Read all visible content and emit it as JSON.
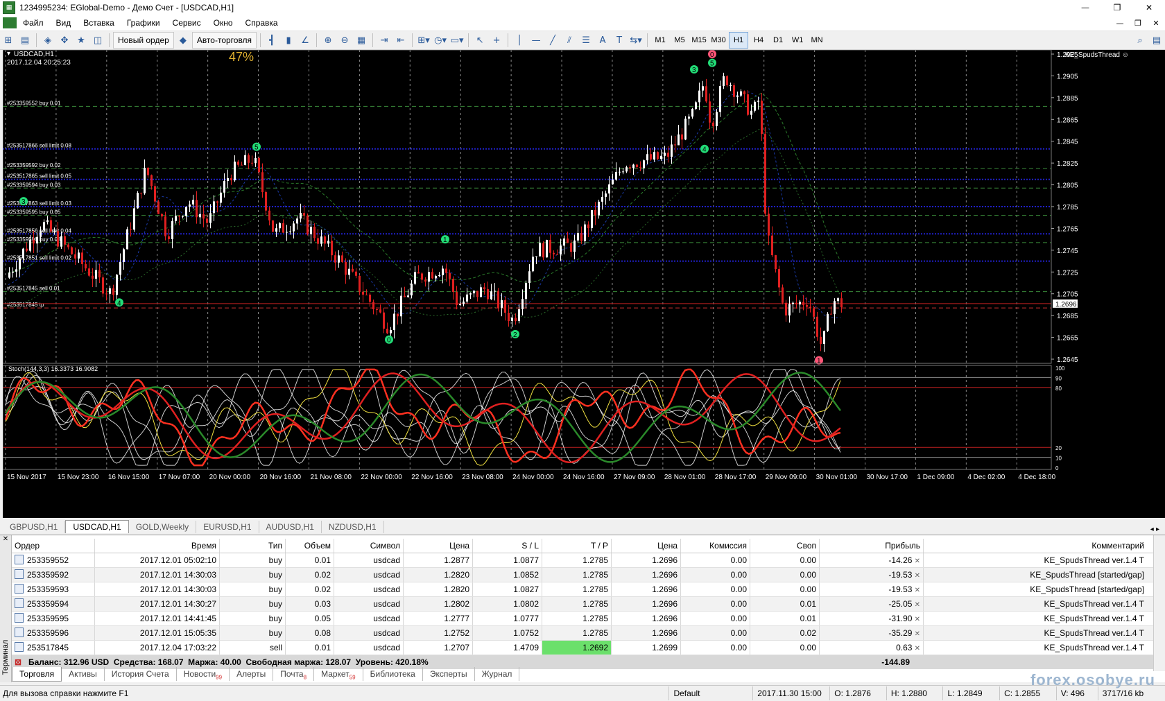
{
  "window": {
    "title": "1234995234: EGlobal-Demo - Демо Счет - [USDCAD,H1]",
    "minimize": "—",
    "maximize": "❐",
    "close": "✕"
  },
  "menu": [
    "Файл",
    "Вид",
    "Вставка",
    "Графики",
    "Сервис",
    "Окно",
    "Справка"
  ],
  "toolbar": {
    "new_order": "Новый ордер",
    "autotrading": "Авто-торговля",
    "timeframes": [
      "M1",
      "M5",
      "M15",
      "M30",
      "H1",
      "H4",
      "D1",
      "W1",
      "MN"
    ],
    "active_tf": "H1"
  },
  "chart": {
    "symbol_label": "USDCAD,H1",
    "datetime": "2017.12.04 20:25:23",
    "progress_label": "47%",
    "expert_label": "KE_SpudsThread ☺",
    "current_price": "1.2696",
    "price_axis": [
      "1.2925",
      "1.2905",
      "1.2885",
      "1.2865",
      "1.2845",
      "1.2825",
      "1.2805",
      "1.2785",
      "1.2765",
      "1.2745",
      "1.2725",
      "1.2705",
      "1.2685",
      "1.2665",
      "1.2645"
    ],
    "order_lines": [
      {
        "label": "#253359552 buy 0.01",
        "price": 1.2877
      },
      {
        "label": "#253517866 sell limit 0.08",
        "price": 1.2838
      },
      {
        "label": "#253359592 buy 0.02",
        "price": 1.282
      },
      {
        "label": "#253517865 sell limit 0.05",
        "price": 1.281
      },
      {
        "label": "#253359594 buy 0.03",
        "price": 1.2802
      },
      {
        "label": "#253517863 sell limit 0.03",
        "price": 1.2785
      },
      {
        "label": "#253359595 buy 0.05",
        "price": 1.2777
      },
      {
        "label": "#253517856 sell limit 0.04",
        "price": 1.276
      },
      {
        "label": "#253359596 buy 0.08",
        "price": 1.2752
      },
      {
        "label": "#253517851 sell limit 0.02",
        "price": 1.2735
      },
      {
        "label": "#253517845 sell 0.01",
        "price": 1.2707
      },
      {
        "label": "#253517845 tp",
        "price": 1.2692
      }
    ],
    "wave_labels": [
      "5",
      "3",
      "4",
      "0",
      "1",
      "2",
      "3",
      "5",
      "4",
      "0",
      "1"
    ],
    "indicator_label": "Stoch(144,3,3) 16.3373 16.9082",
    "indicator_axis": [
      "100",
      "90",
      "80",
      "20",
      "10",
      "0"
    ],
    "time_axis": [
      "15 Nov 2017",
      "15 Nov 23:00",
      "16 Nov 15:00",
      "17 Nov 07:00",
      "20 Nov 00:00",
      "20 Nov 16:00",
      "21 Nov 08:00",
      "22 Nov 00:00",
      "22 Nov 16:00",
      "23 Nov 08:00",
      "24 Nov 00:00",
      "24 Nov 16:00",
      "27 Nov 09:00",
      "28 Nov 01:00",
      "28 Nov 17:00",
      "29 Nov 09:00",
      "30 Nov 01:00",
      "30 Nov 17:00",
      "1 Dec 09:00",
      "4 Dec 02:00",
      "4 Dec 18:00"
    ]
  },
  "chart_tabs": [
    "GBPUSD,H1",
    "USDCAD,H1",
    "GOLD,Weekly",
    "EURUSD,H1",
    "AUDUSD,H1",
    "NZDUSD,H1"
  ],
  "active_chart_tab": "USDCAD,H1",
  "terminal": {
    "side_label": "Терминал",
    "columns": [
      "Ордер",
      "Время",
      "Тип",
      "Объем",
      "Символ",
      "Цена",
      "S / L",
      "T / P",
      "Цена",
      "Комиссия",
      "Своп",
      "Прибыль",
      "Комментарий"
    ],
    "rows": [
      {
        "order": "253359552",
        "time": "2017.12.01 05:02:10",
        "type": "buy",
        "volume": "0.01",
        "symbol": "usdcad",
        "price": "1.2877",
        "sl": "1.0877",
        "tp": "1.2785",
        "cur": "1.2696",
        "commission": "0.00",
        "swap": "0.00",
        "profit": "-14.26",
        "comment": "KE_SpudsThread ver.1.4 T"
      },
      {
        "order": "253359592",
        "time": "2017.12.01 14:30:03",
        "type": "buy",
        "volume": "0.02",
        "symbol": "usdcad",
        "price": "1.2820",
        "sl": "1.0852",
        "tp": "1.2785",
        "cur": "1.2696",
        "commission": "0.00",
        "swap": "0.00",
        "profit": "-19.53",
        "comment": "KE_SpudsThread [started/gap]"
      },
      {
        "order": "253359593",
        "time": "2017.12.01 14:30:03",
        "type": "buy",
        "volume": "0.02",
        "symbol": "usdcad",
        "price": "1.2820",
        "sl": "1.0827",
        "tp": "1.2785",
        "cur": "1.2696",
        "commission": "0.00",
        "swap": "0.00",
        "profit": "-19.53",
        "comment": "KE_SpudsThread [started/gap]"
      },
      {
        "order": "253359594",
        "time": "2017.12.01 14:30:27",
        "type": "buy",
        "volume": "0.03",
        "symbol": "usdcad",
        "price": "1.2802",
        "sl": "1.0802",
        "tp": "1.2785",
        "cur": "1.2696",
        "commission": "0.00",
        "swap": "0.01",
        "profit": "-25.05",
        "comment": "KE_SpudsThread ver.1.4 T"
      },
      {
        "order": "253359595",
        "time": "2017.12.01 14:41:45",
        "type": "buy",
        "volume": "0.05",
        "symbol": "usdcad",
        "price": "1.2777",
        "sl": "1.0777",
        "tp": "1.2785",
        "cur": "1.2696",
        "commission": "0.00",
        "swap": "0.01",
        "profit": "-31.90",
        "comment": "KE_SpudsThread ver.1.4 T"
      },
      {
        "order": "253359596",
        "time": "2017.12.01 15:05:35",
        "type": "buy",
        "volume": "0.08",
        "symbol": "usdcad",
        "price": "1.2752",
        "sl": "1.0752",
        "tp": "1.2785",
        "cur": "1.2696",
        "commission": "0.00",
        "swap": "0.02",
        "profit": "-35.29",
        "comment": "KE_SpudsThread ver.1.4 T"
      },
      {
        "order": "253517845",
        "time": "2017.12.04 17:03:22",
        "type": "sell",
        "volume": "0.01",
        "symbol": "usdcad",
        "price": "1.2707",
        "sl": "1.4709",
        "tp": "1.2692",
        "cur": "1.2699",
        "commission": "0.00",
        "swap": "0.00",
        "profit": "0.63",
        "comment": "KE_SpudsThread ver.1.4 T"
      }
    ],
    "balance_line": "Баланс: 312.96 USD  Средства: 168.07  Маржа: 40.00  Свободная маржа: 128.07  Уровень: 420.18%",
    "total_profit": "-144.89",
    "tabs": [
      {
        "label": "Торговля",
        "badge": ""
      },
      {
        "label": "Активы",
        "badge": ""
      },
      {
        "label": "История Счета",
        "badge": ""
      },
      {
        "label": "Новости",
        "badge": "99"
      },
      {
        "label": "Алерты",
        "badge": ""
      },
      {
        "label": "Почта",
        "badge": "8"
      },
      {
        "label": "Маркет",
        "badge": "59"
      },
      {
        "label": "Библиотека",
        "badge": ""
      },
      {
        "label": "Эксперты",
        "badge": ""
      },
      {
        "label": "Журнал",
        "badge": ""
      }
    ]
  },
  "statusbar": {
    "help": "Для вызова справки нажмите F1",
    "profile": "Default",
    "bar_time": "2017.11.30 15:00",
    "open": "O: 1.2876",
    "high": "H: 1.2880",
    "low": "L: 1.2849",
    "close": "C: 1.2855",
    "volume": "V: 496",
    "traffic": "3717/16 kb"
  },
  "watermark": "forex.osobye.ru",
  "colors": {
    "chart_bg": "#000000",
    "bull_candle": "#ffffff",
    "bear_candle": "#e02020",
    "grid": "#8a8a8a",
    "buy_line": "#3a8a3a",
    "sell_limit_line": "#2020c8",
    "tp_line": "#d03030",
    "wave_green": "#22dd77",
    "wave_pink": "#ff5577"
  }
}
